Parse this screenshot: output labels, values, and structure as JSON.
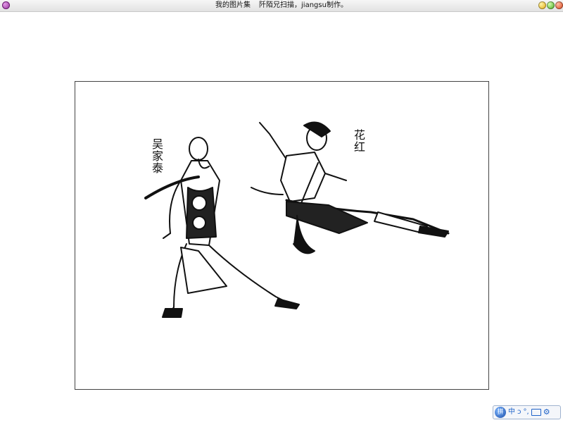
{
  "window": {
    "title_left": "我的图片集",
    "title_right": "阡陌兄扫描，jiangsu制作。"
  },
  "picture": {
    "caption_left": "吴家泰",
    "caption_right": "花红"
  },
  "ime_toolbar": {
    "logo": "拼",
    "mode": "中",
    "punct": "ↄ",
    "width": "°,"
  },
  "colors": {
    "ink": "#111111",
    "frame": "#444444",
    "ime_accent": "#1f63c9"
  }
}
